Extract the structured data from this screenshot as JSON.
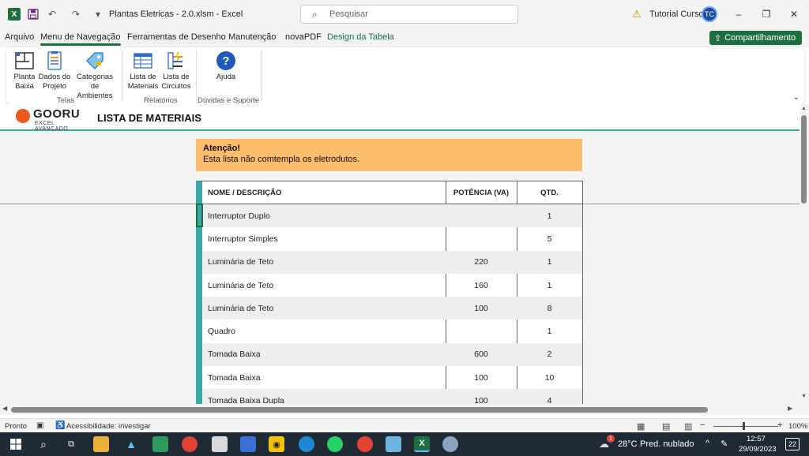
{
  "window": {
    "doc_title": "Plantas Eletricas - 2.0.xlsm  -  Excel",
    "search_placeholder": "Pesquisar",
    "account_name": "Tutorial Cursos",
    "account_initials": "TC",
    "minimize": "–",
    "restore": "❐",
    "close": "✕"
  },
  "ribbon_tabs": [
    {
      "label": "Arquivo"
    },
    {
      "label": "Menu de Navegação"
    },
    {
      "label": "Ferramentas de Desenho"
    },
    {
      "label": "Manutenção"
    },
    {
      "label": "novaPDF"
    },
    {
      "label": "Design da Tabela"
    }
  ],
  "share_button": "Compartilhamento",
  "ribbon": {
    "groups": [
      {
        "label": "Telas"
      },
      {
        "label": "Relatórios"
      },
      {
        "label": "Dúvidas e Suporte"
      }
    ],
    "buttons": [
      {
        "line1": "Planta",
        "line2": "Baixa",
        "icon": "floorplan-icon"
      },
      {
        "line1": "Dados do",
        "line2": "Projeto",
        "icon": "clipboard-icon"
      },
      {
        "line1": "Categorias de",
        "line2": "Ambientes",
        "icon": "tag-icon"
      },
      {
        "line1": "Lista de",
        "line2": "Materiais",
        "icon": "table-list-icon"
      },
      {
        "line1": "Lista de",
        "line2": "Circuitos",
        "icon": "circuit-list-icon"
      },
      {
        "line1": "Ajuda",
        "line2": "",
        "icon": "help-icon"
      }
    ]
  },
  "sheet": {
    "logo_text": "GOORU",
    "logo_sub": "EXCEL AVANÇADO",
    "heading": "LISTA DE MATERIAIS",
    "alert_title": "Atenção!",
    "alert_text": "Esta lista não comtempla os eletrodutos.",
    "table": {
      "headers": [
        "NOME / DESCRIÇÃO",
        "POTÊNCIA (VA)",
        "QTD."
      ],
      "rows": [
        [
          "Interruptor Duplo",
          "",
          "1"
        ],
        [
          "Interruptor Simples",
          "",
          "5"
        ],
        [
          "Luminária de Teto",
          "220",
          "1"
        ],
        [
          "Luminária de Teto",
          "160",
          "1"
        ],
        [
          "Luminária de Teto",
          "100",
          "8"
        ],
        [
          "Quadro",
          "",
          "1"
        ],
        [
          "Tomada Baixa",
          "600",
          "2"
        ],
        [
          "Tomada Baixa",
          "100",
          "10"
        ],
        [
          "Tomada Baixa Dupla",
          "100",
          "4"
        ]
      ]
    }
  },
  "statusbar": {
    "ready": "Pronto",
    "accessibility": "Acessibilidade: investigar",
    "zoom": "100%"
  },
  "taskbar": {
    "weather_temp": "28°C",
    "weather_desc": "Pred. nublado",
    "time": "12:57",
    "date": "29/09/2023",
    "notifications": "22",
    "weather_badge": "1"
  },
  "colors": {
    "excel_green": "#1d6f42",
    "teal_accent": "#3aa7a8",
    "alert_orange": "#fbbd6b"
  }
}
